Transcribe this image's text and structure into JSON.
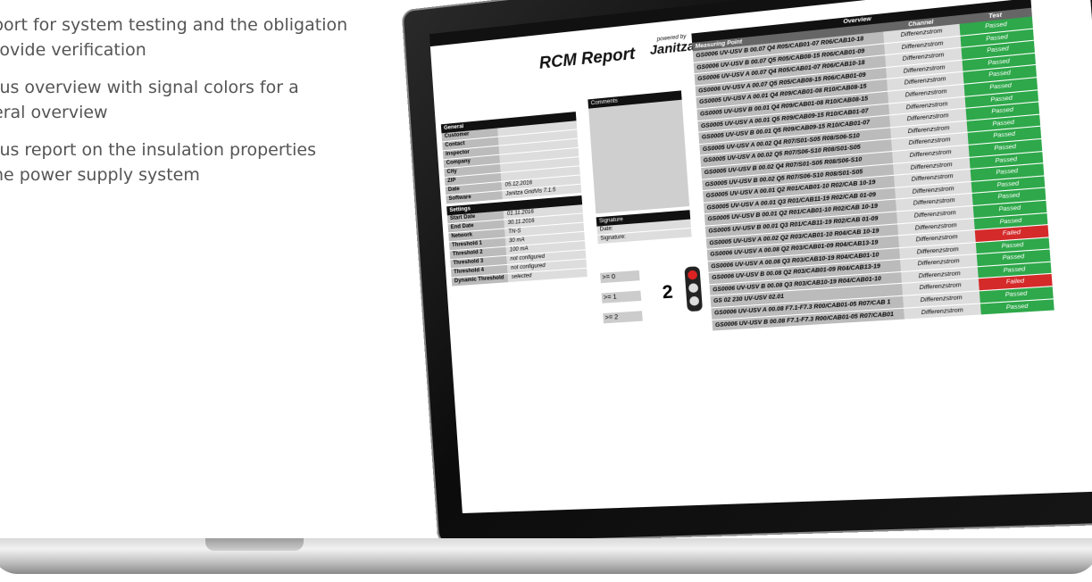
{
  "features": [
    {
      "line1": "port for system testing and the obligation",
      "line2": "rovide verification"
    },
    {
      "line1": "tus overview with signal colors for a",
      "line2": "eral overview"
    },
    {
      "line1": "tus report on the insulation properties",
      "line2": "he power supply system"
    }
  ],
  "report": {
    "title": "RCM Report",
    "brand_small": "powered by",
    "brand": "Janitza",
    "general_header": "General",
    "general": [
      {
        "k": "Customer",
        "v": ""
      },
      {
        "k": "Contact",
        "v": ""
      },
      {
        "k": "Inspector",
        "v": ""
      },
      {
        "k": "Company",
        "v": ""
      },
      {
        "k": "City",
        "v": ""
      },
      {
        "k": "ZIP",
        "v": ""
      },
      {
        "k": "Date",
        "v": "05.12.2016"
      },
      {
        "k": "Software",
        "v": "Janitza GridVis 7.1.5"
      }
    ],
    "settings_header": "Settings",
    "settings": [
      {
        "k": "Start Date",
        "v": "01.11.2016"
      },
      {
        "k": "End Date",
        "v": "30.11.2016"
      },
      {
        "k": "Network",
        "v": "TN-S"
      },
      {
        "k": "Threshold 1",
        "v": "30 mA"
      },
      {
        "k": "Threshold 2",
        "v": "100 mA"
      },
      {
        "k": "Threshold 3",
        "v": "not configured"
      },
      {
        "k": "Threshold 4",
        "v": "not configured"
      },
      {
        "k": "Dynamic Threshold",
        "v": "selected"
      }
    ],
    "comments_header": "Comments",
    "signature_header": "Signature",
    "date_label": "Date:",
    "signature_label": "Signature:",
    "signal_levels": [
      ">= 0",
      ">= 1",
      ">= 2"
    ],
    "signal_count": "2",
    "overview_header": "Overview",
    "col_measuring": "Measuring Point",
    "col_channel": "Channel",
    "col_test": "Test",
    "colors": {
      "passed": "#2ea84a",
      "failed": "#d42a2a"
    },
    "rows": [
      {
        "mp": "GS0006 UV-USV B 00.07 Q4 R05/CAB01-07  R06/CAB10-18",
        "ch": "Differenzstrom",
        "ts": "Passed",
        "status": "passed"
      },
      {
        "mp": "GS0006 UV-USV B 00.07 Q5 R05/CAB08-15  R06/CAB01-09",
        "ch": "Differenzstrom",
        "ts": "Passed",
        "status": "passed"
      },
      {
        "mp": "GS0006 UV-USV A 00.07 Q4 R05/CAB01-07  R06/CAB10-18",
        "ch": "Differenzstrom",
        "ts": "Passed",
        "status": "passed"
      },
      {
        "mp": "GS0006 UV-USV A 00.07 Q5 R05/CAB08-15  R06/CAB01-09",
        "ch": "Differenzstrom",
        "ts": "Passed",
        "status": "passed"
      },
      {
        "mp": "GS0005 UV-USV A 00.01 Q4 R09/CAB01-08 R10/CAB08-15",
        "ch": "Differenzstrom",
        "ts": "Passed",
        "status": "passed"
      },
      {
        "mp": "GS0005 UV-USV B 00.01 Q4 R09/CAB01-08 R10/CAB08-15",
        "ch": "Differenzstrom",
        "ts": "Passed",
        "status": "passed"
      },
      {
        "mp": "GS0005 UV-USV A 00.01 Q5 R09/CAB09-15 R10/CAB01-07",
        "ch": "Differenzstrom",
        "ts": "Passed",
        "status": "passed"
      },
      {
        "mp": "GS0005 UV-USV B 00.01 Q5 R09/CAB09-15 R10/CAB01-07",
        "ch": "Differenzstrom",
        "ts": "Passed",
        "status": "passed"
      },
      {
        "mp": "GS0005 UV-USV A 00.02 Q4 R07/S01-S05 R08/S06-S10",
        "ch": "Differenzstrom",
        "ts": "Passed",
        "status": "passed"
      },
      {
        "mp": "GS0005 UV-USV A 00.02 Q5 R07/S06-S10 R08/S01-S05",
        "ch": "Differenzstrom",
        "ts": "Passed",
        "status": "passed"
      },
      {
        "mp": "GS0005 UV-USV B 00.02 Q4 R07/S01-S05 R08/S06-S10",
        "ch": "Differenzstrom",
        "ts": "Passed",
        "status": "passed"
      },
      {
        "mp": "GS0005 UV-USV B 00.02 Q5 R07/S06-S10 R08/S01-S05",
        "ch": "Differenzstrom",
        "ts": "Passed",
        "status": "passed"
      },
      {
        "mp": "GS0005 UV-USV A 00.01 Q2 R01/CAB01-10 R02/CAB 10-19",
        "ch": "Differenzstrom",
        "ts": "Passed",
        "status": "passed"
      },
      {
        "mp": "GS0005 UV-USV A 00.01 Q3 R01/CAB11-19 R02/CAB 01-09",
        "ch": "Differenzstrom",
        "ts": "Passed",
        "status": "passed"
      },
      {
        "mp": "GS0005 UV-USV B 00.01 Q2 R01/CAB01-10 R02/CAB 10-19",
        "ch": "Differenzstrom",
        "ts": "Passed",
        "status": "passed"
      },
      {
        "mp": "GS0005 UV-USV B 00.01 Q3 R01/CAB11-19 R02/CAB 01-09",
        "ch": "Differenzstrom",
        "ts": "Passed",
        "status": "passed"
      },
      {
        "mp": "GS0005 UV-USV A 00.02 Q2 R03/CAB01-10 R04/CAB 10-19",
        "ch": "Differenzstrom",
        "ts": "Passed",
        "status": "passed"
      },
      {
        "mp": "GS0006 UV-USV A 00.08 Q2 R03/CAB01-09 R04/CAB13-19",
        "ch": "Differenzstrom",
        "ts": "Failed",
        "status": "failed"
      },
      {
        "mp": "GS0006 UV-USV A 00.08 Q3 R03/CAB10-19 R04/CAB01-10",
        "ch": "Differenzstrom",
        "ts": "Passed",
        "status": "passed"
      },
      {
        "mp": "GS0006 UV-USV B 00.08 Q2 R03/CAB01-09 R04/CAB13-19",
        "ch": "Differenzstrom",
        "ts": "Passed",
        "status": "passed"
      },
      {
        "mp": "GS0006 UV-USV B 00.08 Q3 R03/CAB10-19 R04/CAB01-10",
        "ch": "Differenzstrom",
        "ts": "Passed",
        "status": "passed"
      },
      {
        "mp": "GS 02 230 UV-USV 02.01",
        "ch": "Differenzstrom",
        "ts": "Failed",
        "status": "failed"
      },
      {
        "mp": "GS0006 UV-USV A 00.08 F7.1-F7.3 R00/CAB01-05 R07/CAB 1",
        "ch": "Differenzstrom",
        "ts": "Passed",
        "status": "passed"
      },
      {
        "mp": "GS0006 UV-USV B 00.08 F7.1-F7.3 R00/CAB01-05 R07/CAB01",
        "ch": "Differenzstrom",
        "ts": "Passed",
        "status": "passed"
      }
    ]
  }
}
